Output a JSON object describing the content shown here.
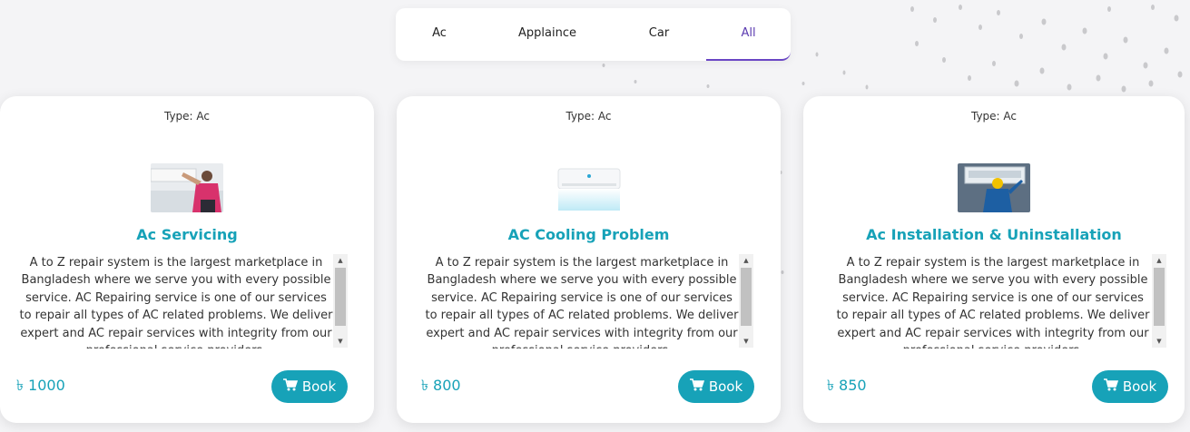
{
  "filter_tabs": [
    {
      "label": "Ac",
      "active": false
    },
    {
      "label": "Applaince",
      "active": false
    },
    {
      "label": "Car",
      "active": false
    },
    {
      "label": "All",
      "active": true
    }
  ],
  "colors": {
    "accent": "#17a2b8",
    "active_tab": "#5b3bb0",
    "background": "#f4f4f6"
  },
  "services": [
    {
      "type": "Type: Ac",
      "title": "Ac Servicing",
      "image_icon": "technician-servicing-ac-photo",
      "description": "A to Z repair system is the largest marketplace in Bangladesh where we serve you with every possible service. AC Repairing service is one of our services to repair all types of AC related problems. We deliver expert and AC repair services with integrity from our professional service providers.",
      "price": "৳ 1000",
      "book_label": "Book"
    },
    {
      "type": "Type: Ac",
      "title": "AC Cooling Problem",
      "image_icon": "air-conditioner-unit-photo",
      "description": "A to Z repair system is the largest marketplace in Bangladesh where we serve you with every possible service. AC Repairing service is one of our services to repair all types of AC related problems. We deliver expert and AC repair services with integrity from our professional service providers.",
      "price": "৳ 800",
      "book_label": "Book"
    },
    {
      "type": "Type: Ac",
      "title": "Ac Installation & Uninstallation",
      "image_icon": "technician-installing-ac-photo",
      "description": "A to Z repair system is the largest marketplace in Bangladesh where we serve you with every possible service. AC Repairing service is one of our services to repair all types of AC related problems. We deliver expert and AC repair services with integrity from our professional service providers.",
      "price": "৳ 850",
      "book_label": "Book"
    }
  ]
}
